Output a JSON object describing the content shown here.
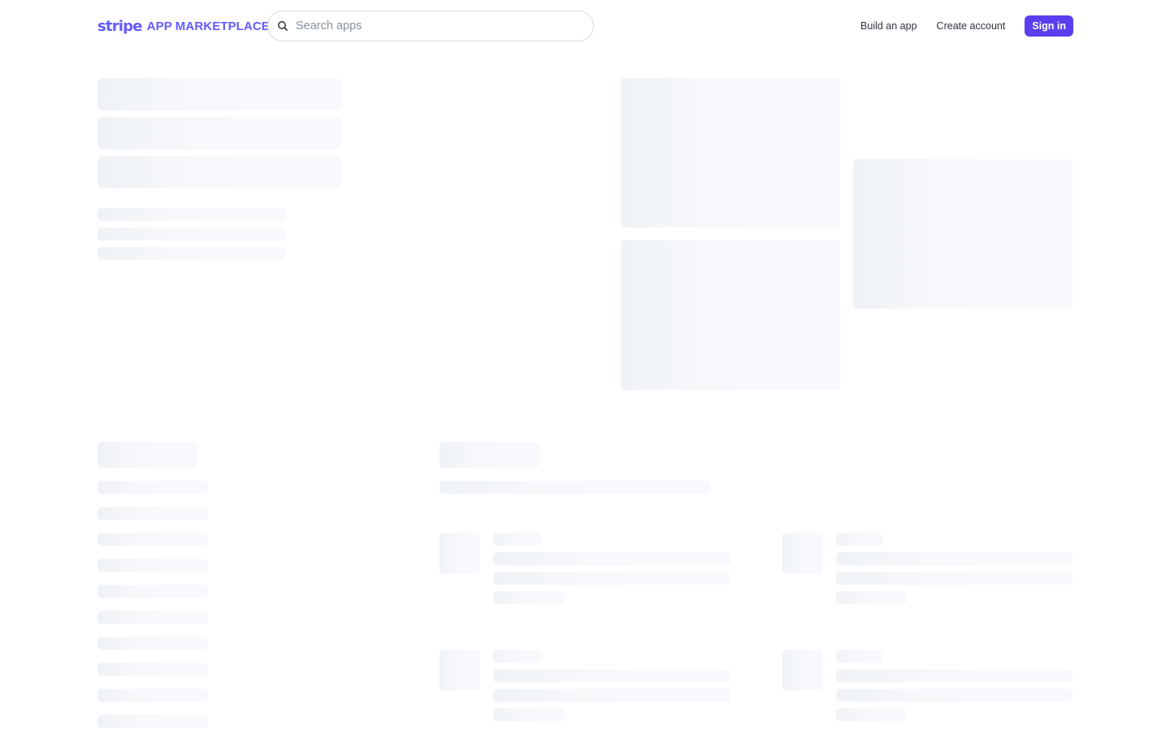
{
  "header": {
    "logo_wordmark": "stripe",
    "logo_product": "APP MARKETPLACE",
    "search": {
      "placeholder": "Search apps",
      "value": ""
    },
    "nav": {
      "build_app": "Build an app",
      "create_account": "Create account",
      "sign_in": "Sign in"
    }
  },
  "icons": {
    "search": "search-icon"
  },
  "colors": {
    "brand": "#635bff",
    "sign_in_button": "#5a3ff0",
    "skeleton": "#f3f6f9"
  },
  "state": "loading"
}
